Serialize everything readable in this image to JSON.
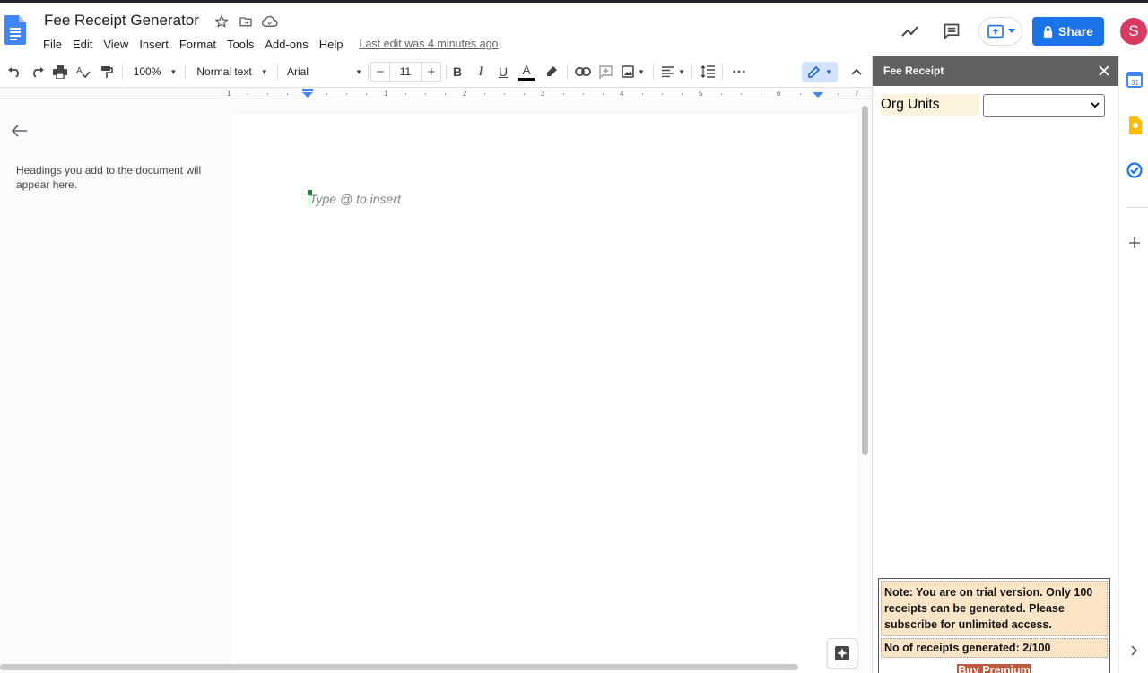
{
  "app": {
    "title": "Fee Receipt Generator",
    "last_edit": "Last edit was 4 minutes ago",
    "share_label": "Share",
    "avatar_initial": "S",
    "accent": "#1a73e8"
  },
  "menu": [
    "File",
    "Edit",
    "View",
    "Insert",
    "Format",
    "Tools",
    "Add-ons",
    "Help"
  ],
  "toolbar": {
    "zoom": "100%",
    "style": "Normal text",
    "font": "Arial",
    "font_size": "11",
    "minus": "−",
    "plus": "+",
    "bold": "B",
    "italic": "I",
    "underline": "U",
    "text_color": "A",
    "more": "⋯"
  },
  "ruler": {
    "ticks": [
      "1",
      "1",
      "2",
      "3",
      "4",
      "5",
      "6",
      "7"
    ]
  },
  "outline": {
    "hint": "Headings you add to the document will appear here."
  },
  "document": {
    "placeholder": "Type @ to insert"
  },
  "side_panel": {
    "title": "Fee Receipt",
    "org_units_label": "Org Units",
    "org_units_value": "",
    "note": "Note: You are on trial version. Only 100 receipts can be generated. Please subscribe for unlimited access.",
    "receipts_count": "No of receipts generated: 2/100",
    "buy_label": "Buy Premium",
    "header_color": "#616161",
    "note_bg": "#fce5c6",
    "buy_color": "#c05a3d"
  },
  "rail": {
    "calendar_day": "31"
  }
}
